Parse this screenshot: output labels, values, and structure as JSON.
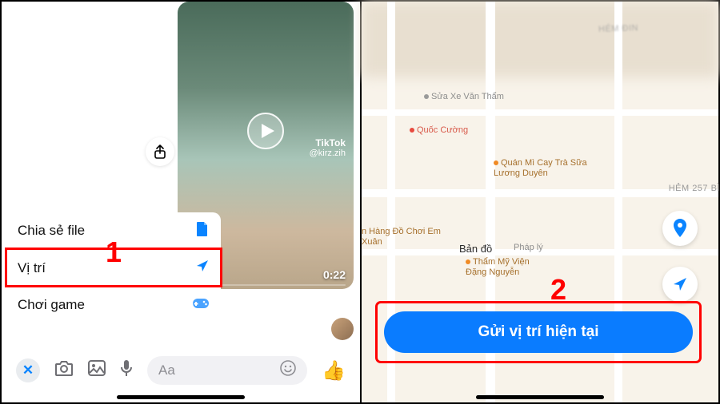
{
  "left": {
    "share_icon_char": "⇪",
    "tiktok": {
      "brand": "TikTok",
      "handle": "@kirz.zih"
    },
    "video_time": "0:22",
    "attachment_menu": [
      {
        "label": "Chia sẻ file",
        "icon": "file-icon"
      },
      {
        "label": "Vị trí",
        "icon": "location-arrow-icon"
      },
      {
        "label": "Chơi game",
        "icon": "game-controller-icon"
      }
    ],
    "step1_number": "1",
    "composer": {
      "placeholder": "Aa",
      "close": "✕",
      "thumb": "👍"
    }
  },
  "right": {
    "pois": {
      "sua_xe": "Sửa Xe Văn Thẩm",
      "quoc_cuong": "Quốc Cường",
      "quan_mi": "Quán Mì Cay Trà Sữa Lương Duyên",
      "do_choi": "n Hàng Đồ Chơi Em Xuân",
      "tham_my": "Thẩm Mỹ Viện Đặng Nguyễn",
      "phap_ly": "Pháp lý"
    },
    "hem_top": "HÉM ĐIN",
    "hem_right": "HẺM 257 BÌ",
    "apple_maps_label": "Bản đồ",
    "send_button": "Gửi vị trí hiện tại",
    "step2_number": "2"
  }
}
